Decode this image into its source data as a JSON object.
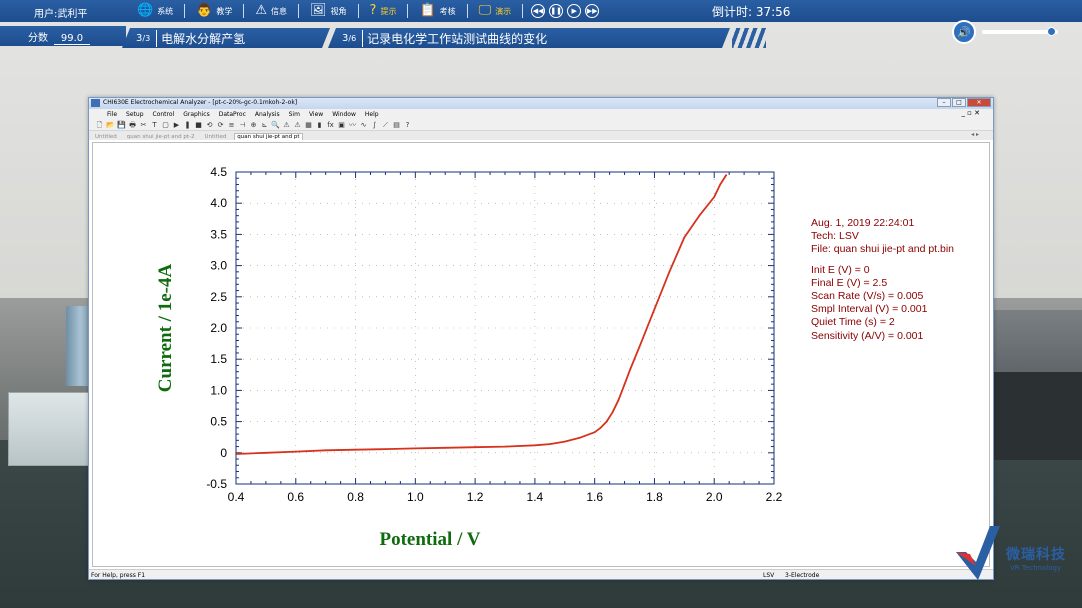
{
  "topbar": {
    "user": "用户:武利平",
    "menu": [
      {
        "icon": "globe-icon",
        "glyph": "🌐",
        "label": "系统",
        "highlight": false
      },
      {
        "icon": "teacher-icon",
        "glyph": "👨",
        "label": "教学",
        "highlight": false
      },
      {
        "icon": "warning-icon",
        "glyph": "⚠",
        "label": "信息",
        "highlight": false
      },
      {
        "icon": "image-icon",
        "glyph": "🖼",
        "label": "视角",
        "highlight": false
      },
      {
        "icon": "question-icon",
        "glyph": "?",
        "label": "提示",
        "highlight": true
      },
      {
        "icon": "clipboard-icon",
        "glyph": "📋",
        "label": "考核",
        "highlight": false
      },
      {
        "icon": "monitor-icon",
        "glyph": "🖵",
        "label": "演示",
        "highlight": true
      }
    ],
    "timer": "倒计时: 37:56"
  },
  "score": {
    "label": "分数",
    "value": "99.0"
  },
  "steps": [
    {
      "num": "3",
      "den": "3",
      "text": "电解水分解产氢"
    },
    {
      "num": "3",
      "den": "6",
      "text": "记录电化学工作站测试曲线的变化"
    }
  ],
  "volume": {
    "level": 0.92
  },
  "app": {
    "title": "CHI630E Electrochemical Analyzer - [pt-c-20%-gc-0.1mkoh-2-ok]",
    "menu": [
      "File",
      "Setup",
      "Control",
      "Graphics",
      "DataProc",
      "Analysis",
      "Sim",
      "View",
      "Window",
      "Help"
    ],
    "tabs": [
      "Untitled",
      "quan shui jie-pt and pt-2",
      "Untitled",
      "quan shui jie-pt and pt"
    ],
    "active_tab": 3,
    "status_left": "For Help, press F1",
    "status_mid": "LSV",
    "status_right": "3-Electrode"
  },
  "info": {
    "date": "Aug. 1, 2019   22:24:01",
    "tech": "Tech: LSV",
    "file": "File: quan shui jie-pt and pt.bin",
    "params": [
      "Init E (V) = 0",
      "Final E (V) = 2.5",
      "Scan Rate (V/s) = 0.005",
      "Smpl Interval (V) = 0.001",
      "Quiet Time (s) = 2",
      "Sensitivity (A/V) = 0.001"
    ]
  },
  "logo": {
    "cn": "微瑞科技",
    "en": "VR Technology"
  },
  "chart_data": {
    "type": "line",
    "xlabel": "Potential / V",
    "ylabel": "Current / 1e-4A",
    "xlim": [
      0.4,
      2.2
    ],
    "ylim": [
      -0.5,
      4.5
    ],
    "xticks": [
      "0.4",
      "0.6",
      "0.8",
      "1.0",
      "1.2",
      "1.4",
      "1.6",
      "1.8",
      "2.0",
      "2.2"
    ],
    "yticks": [
      "4.5",
      "4.0",
      "3.5",
      "3.0",
      "2.5",
      "2.0",
      "1.5",
      "1.0",
      "0.5",
      "0",
      "-0.5"
    ],
    "grid": true,
    "color": "#d6321c",
    "series": [
      {
        "x": [
          0.4,
          0.5,
          0.6,
          0.7,
          0.8,
          0.9,
          1.0,
          1.1,
          1.2,
          1.3,
          1.4,
          1.45,
          1.5,
          1.55,
          1.6,
          1.62,
          1.64,
          1.66,
          1.68,
          1.7,
          1.72,
          1.75,
          1.8,
          1.85,
          1.9,
          1.95,
          2.0,
          2.02,
          2.04
        ],
        "y": [
          -0.02,
          0.0,
          0.02,
          0.04,
          0.05,
          0.06,
          0.07,
          0.08,
          0.09,
          0.1,
          0.12,
          0.14,
          0.18,
          0.24,
          0.33,
          0.4,
          0.5,
          0.65,
          0.85,
          1.1,
          1.35,
          1.7,
          2.3,
          2.9,
          3.45,
          3.8,
          4.1,
          4.3,
          4.45
        ]
      }
    ]
  }
}
